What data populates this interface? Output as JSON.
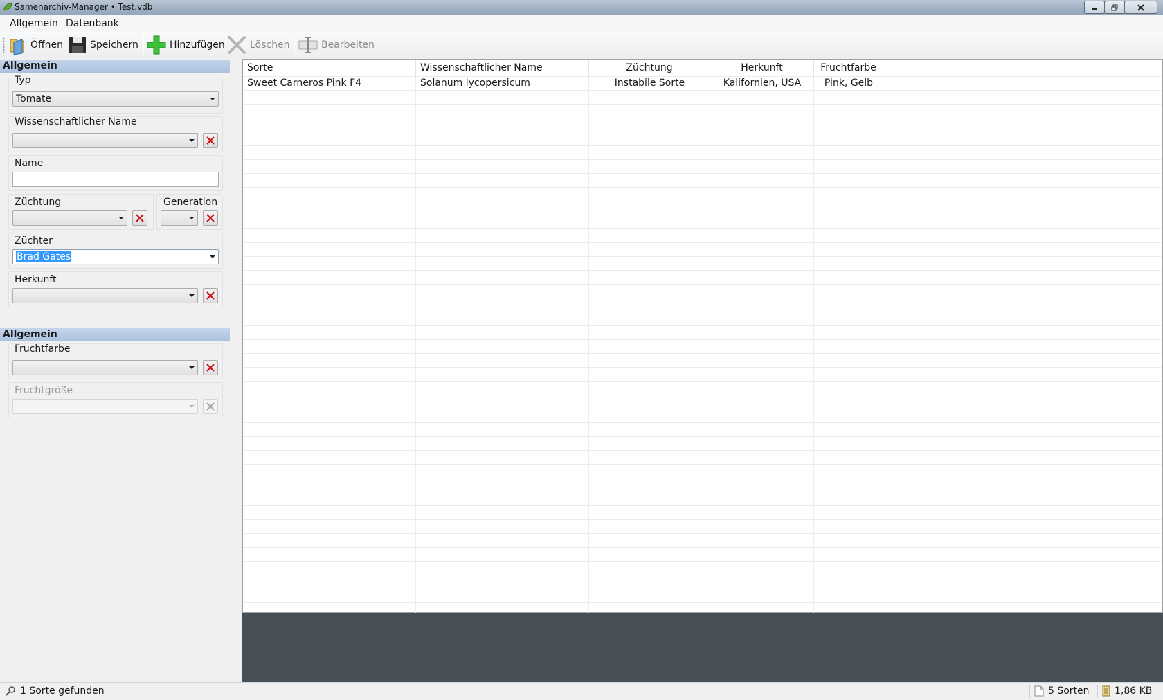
{
  "window": {
    "title": "Samenarchiv-Manager • Test.vdb"
  },
  "menu": {
    "items": [
      "Allgemein",
      "Datenbank"
    ]
  },
  "toolbar": {
    "open_label": "Öffnen",
    "save_label": "Speichern",
    "add_label": "Hinzufügen",
    "delete_label": "Löschen",
    "edit_label": "Bearbeiten"
  },
  "filters": {
    "section1_title": "Allgemein",
    "typ_label": "Typ",
    "typ_value": "Tomate",
    "wiss_name_label": "Wissenschaftlicher Name",
    "wiss_name_value": "",
    "name_label": "Name",
    "name_value": "",
    "zuechtung_label": "Züchtung",
    "zuechtung_value": "",
    "generation_label": "Generation",
    "generation_value": "",
    "zuechter_label": "Züchter",
    "zuechter_value": "Brad Gates",
    "herkunft_label": "Herkunft",
    "herkunft_value": "",
    "section2_title": "Allgemein",
    "fruchtfarbe_label": "Fruchtfarbe",
    "fruchtfarbe_value": "",
    "fruchtgroesse_label": "Fruchtgröße",
    "fruchtgroesse_value": ""
  },
  "table": {
    "columns": [
      "Sorte",
      "Wissenschaftlicher Name",
      "Züchtung",
      "Herkunft",
      "Fruchtfarbe"
    ],
    "rows": [
      [
        "Sweet Carneros Pink F4",
        "Solanum lycopersicum",
        "Instabile Sorte",
        "Kalifornien, USA",
        "Pink, Gelb"
      ]
    ]
  },
  "status": {
    "found": "1 Sorte gefunden",
    "count": "5 Sorten",
    "size": "1,86 KB"
  },
  "colors": {
    "section_header": "#aac1de",
    "bottom_panel": "#475057",
    "selection": "#3399ff",
    "clear_x": "#d01010"
  }
}
